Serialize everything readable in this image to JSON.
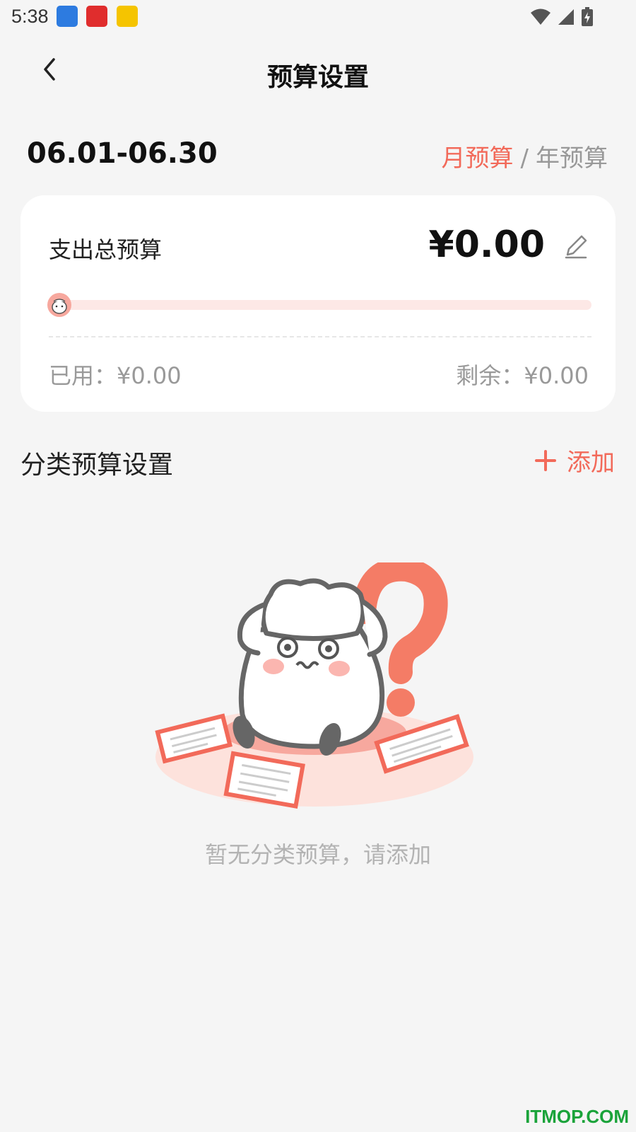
{
  "status_bar": {
    "time": "5:38"
  },
  "header": {
    "title": "预算设置"
  },
  "period": {
    "range": "06.01-06.30"
  },
  "mode_switch": {
    "month": "月预算",
    "separator": "/",
    "year": "年预算"
  },
  "budget_card": {
    "label": "支出总预算",
    "amount": "¥0.00",
    "progress_fraction": 0,
    "used": "已用：¥0.00",
    "remaining": "剩余：¥0.00"
  },
  "category_section": {
    "title": "分类预算设置",
    "add_label": "添加",
    "empty_message": "暂无分类预算，请添加"
  },
  "watermark": "ITMOP.COM",
  "colors": {
    "accent": "#f26a5a",
    "background": "#f5f5f5",
    "muted": "#999999"
  }
}
